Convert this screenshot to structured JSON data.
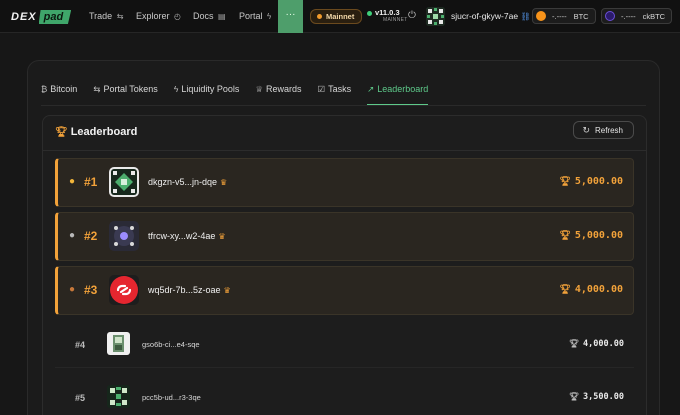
{
  "brand": {
    "part1": "DEX",
    "part2": "pad"
  },
  "nav": [
    {
      "label": "Trade",
      "icon": "⇆"
    },
    {
      "label": "Explorer",
      "icon": "◴"
    },
    {
      "label": "Docs",
      "icon": "▤"
    },
    {
      "label": "Portal",
      "icon": "ϟ"
    }
  ],
  "more_label": "···",
  "network": {
    "label": "Mainnet",
    "version": "v11.0.3",
    "net_caption": "MAINNET"
  },
  "account": {
    "name": "sjucr-of-gkyw-7ae"
  },
  "balances": [
    {
      "amount": "-.----",
      "symbol": "BTC",
      "color": "#f7931a"
    },
    {
      "amount": "-.----",
      "symbol": "ckBTC",
      "color": "#3b00b9"
    }
  ],
  "tabs": [
    {
      "label": "Bitcoin",
      "icon": "₿",
      "active": false
    },
    {
      "label": "Portal Tokens",
      "icon": "⇆",
      "active": false
    },
    {
      "label": "Liquidity Pools",
      "icon": "ϟ",
      "active": false
    },
    {
      "label": "Rewards",
      "icon": "♕",
      "active": false
    },
    {
      "label": "Tasks",
      "icon": "☑",
      "active": false
    },
    {
      "label": "Leaderboard",
      "icon": "↗",
      "active": true
    }
  ],
  "leaderboard": {
    "title": "Leaderboard",
    "refresh_label": "Refresh",
    "rows": [
      {
        "rank": "#1",
        "medal": "gold",
        "name": "dkgzn-v5...jn-dqe",
        "score": "5,000.00",
        "crown": true
      },
      {
        "rank": "#2",
        "medal": "silver",
        "name": "tfrcw-xy...w2-4ae",
        "score": "5,000.00",
        "crown": true
      },
      {
        "rank": "#3",
        "medal": "bronze",
        "name": "wq5dr-7b...5z-oae",
        "score": "4,000.00",
        "crown": true
      },
      {
        "rank": "#4",
        "medal": "",
        "name": "gso6b-ci...e4-sqe",
        "score": "4,000.00",
        "crown": false
      },
      {
        "rank": "#5",
        "medal": "",
        "name": "pcc5b-ud...r3-3qe",
        "score": "3,500.00",
        "crown": false
      }
    ]
  },
  "colors": {
    "accent": "#5ec98a",
    "gold": "#f2a23a",
    "background": "#171717"
  }
}
